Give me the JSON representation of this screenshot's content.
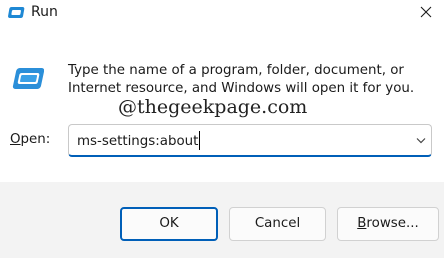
{
  "window": {
    "title": "Run",
    "app_icon": "run-app-icon",
    "close_icon": "close-icon"
  },
  "dialog": {
    "icon": "run-dialog-icon",
    "instructions_line1": "Type the name of a program, folder, document, or",
    "instructions_line2": "Internet resource, and Windows will open it for you.",
    "watermark": "@thegeekpage.com"
  },
  "open_field": {
    "label_mnemonic": "O",
    "label_rest": "pen:",
    "value": "ms-settings:about",
    "dropdown_icon": "chevron-down-icon"
  },
  "buttons": {
    "ok": "OK",
    "cancel": "Cancel",
    "browse_mnemonic": "B",
    "browse_rest": "rowse..."
  },
  "colors": {
    "accent": "#005fb8",
    "footer_bg": "#f3f3f3",
    "icon_blue": "#1e88d4"
  }
}
